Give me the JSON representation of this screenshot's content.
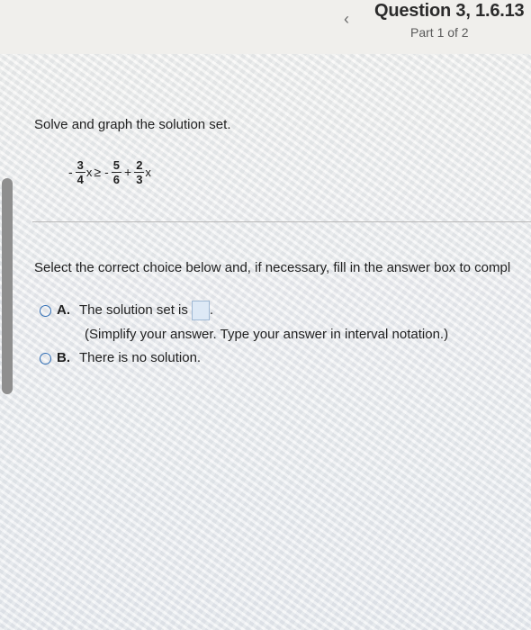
{
  "header": {
    "back_glyph": "‹",
    "title": "Question 3, 1.6.13",
    "part": "Part 1 of 2"
  },
  "question": {
    "prompt": "Solve and graph the solution set.",
    "inequality": {
      "lhs_sign": "-",
      "lhs_num": "3",
      "lhs_den": "4",
      "lhs_var": "x",
      "relation": "≥",
      "rhs1_sign": "-",
      "rhs1_num": "5",
      "rhs1_den": "6",
      "plus": "+",
      "rhs2_num": "2",
      "rhs2_den": "3",
      "rhs2_var": "x"
    },
    "instruction": "Select the correct choice below and, if necessary, fill in the answer box to compl"
  },
  "choices": [
    {
      "letter": "A.",
      "text": "The solution set is",
      "after_box": ".",
      "hint": "(Simplify your answer. Type your answer in interval notation.)",
      "answer_value": ""
    },
    {
      "letter": "B.",
      "text": "There is no solution."
    }
  ],
  "colors": {
    "radio_border": "#2f6db5",
    "answer_box_fill": "#dde9f6"
  }
}
